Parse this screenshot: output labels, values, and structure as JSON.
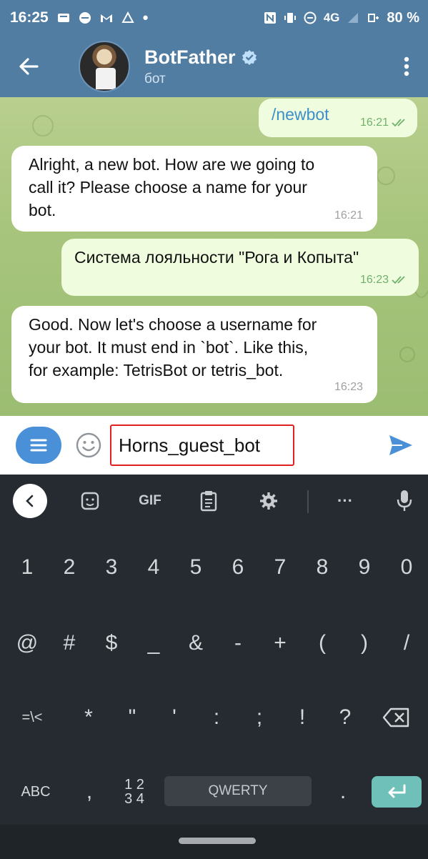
{
  "status_bar": {
    "time": "16:25",
    "network": "4G",
    "battery": "80 %"
  },
  "header": {
    "title": "BotFather",
    "subtitle": "бот"
  },
  "messages": [
    {
      "direction": "out",
      "text": "/newbot",
      "time": "16:21"
    },
    {
      "direction": "in",
      "lines": [
        "Alright, a new bot. How are we going to",
        "call it? Please choose a name for your",
        "bot."
      ],
      "time": "16:21"
    },
    {
      "direction": "out",
      "text": "Система лояльности \"Рога и Копыта\"",
      "time": "16:23"
    },
    {
      "direction": "in",
      "lines": [
        "Good. Now let's choose a username for",
        "your bot. It must end in `bot`. Like this,",
        "for example: TetrisBot or tetris_bot."
      ],
      "time": "16:23"
    }
  ],
  "input": {
    "value": "Horns_guest_bot"
  },
  "keyboard": {
    "toolbar": {
      "gif": "GIF",
      "more": "···"
    },
    "row1": [
      "1",
      "2",
      "3",
      "4",
      "5",
      "6",
      "7",
      "8",
      "9",
      "0"
    ],
    "row2": [
      "@",
      "#",
      "$",
      "_",
      "&",
      "-",
      "+",
      "(",
      ")",
      "/"
    ],
    "row3": [
      "=\\<",
      "*",
      "\"",
      "'",
      ":",
      ";",
      "!",
      "?"
    ],
    "row4": {
      "abc": "ABC",
      "comma": ",",
      "numpad_top": "1 2",
      "numpad_bottom": "3 4",
      "space": "QWERTY",
      "period": "."
    }
  },
  "colors": {
    "header": "#517da2",
    "outgoing_bubble": "#effdde",
    "incoming_bubble": "#ffffff",
    "keyboard": "#252b30",
    "highlight_border": "#e02020",
    "enter_key": "#6ec0b8"
  }
}
